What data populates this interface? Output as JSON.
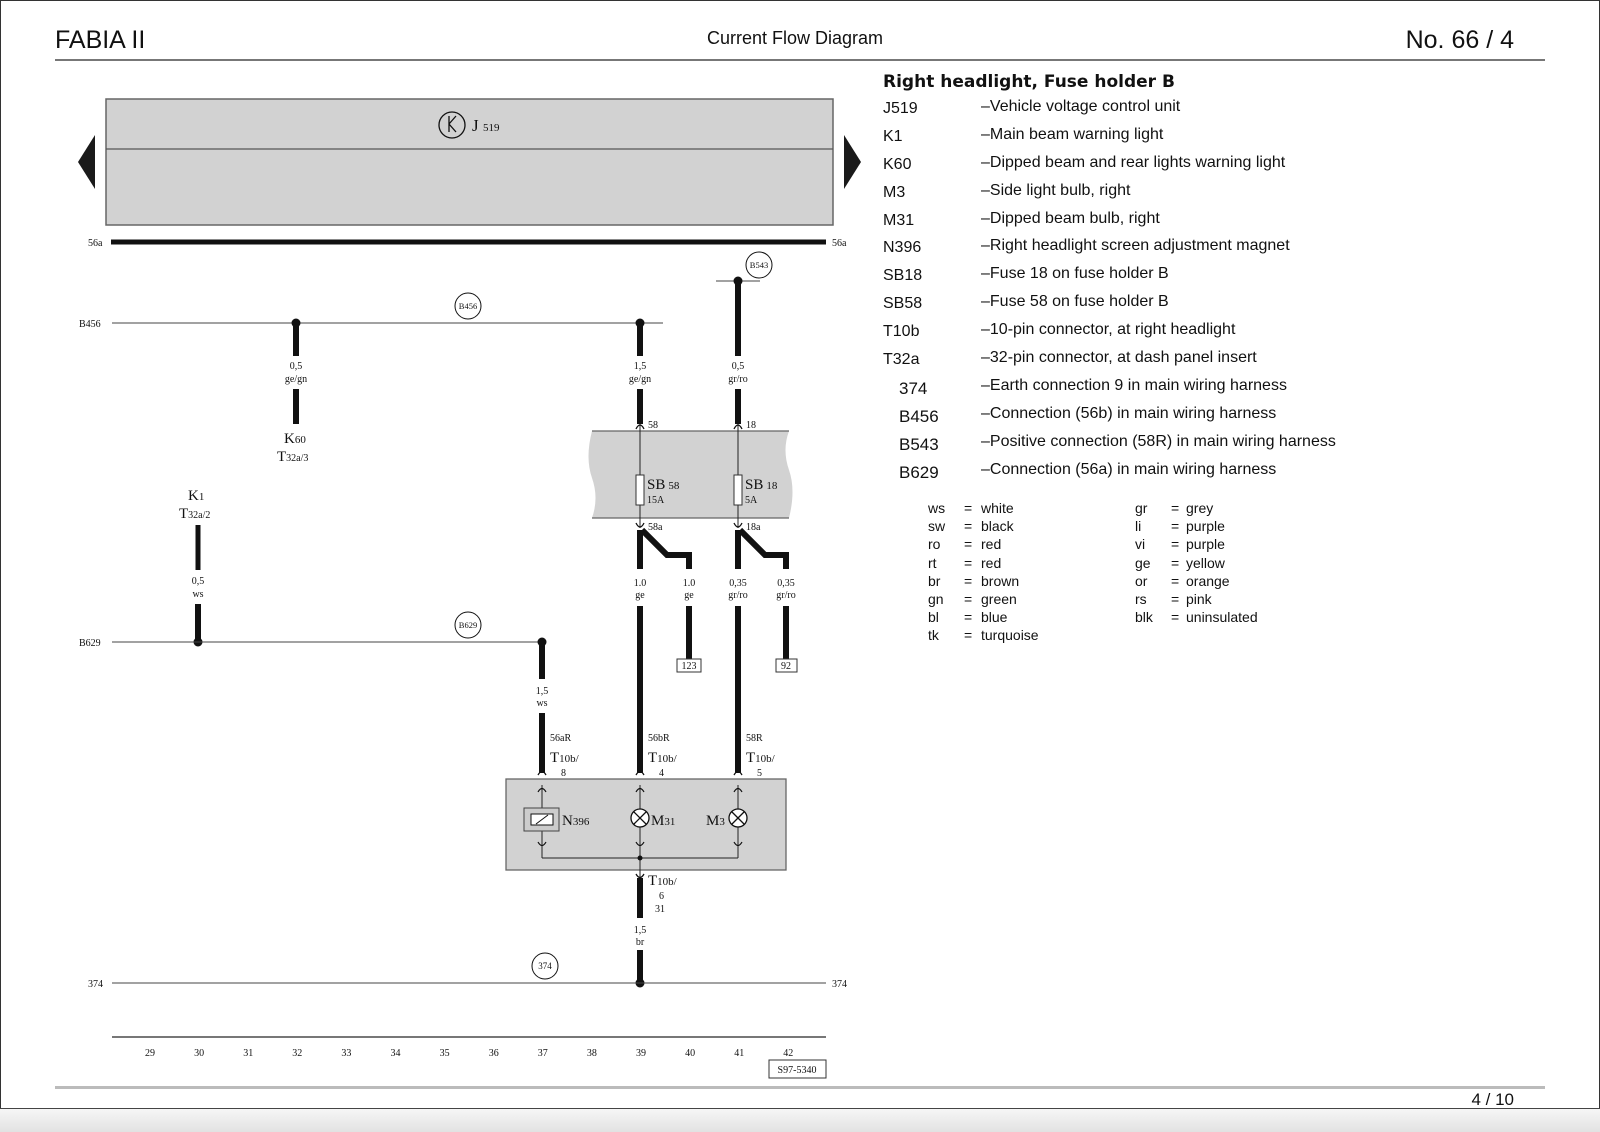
{
  "header": {
    "model": "FABIA II",
    "title": "Current Flow Diagram",
    "doc_number": "No.  66 / 4"
  },
  "footer": {
    "page": "4 /  10"
  },
  "legend": {
    "title": "Right headlight, Fuse holder B",
    "items": [
      {
        "code": "J519",
        "desc": "–Vehicle voltage control unit"
      },
      {
        "code": "K1",
        "desc": "–Main beam warning light"
      },
      {
        "code": "K60",
        "desc": "–Dipped beam and rear lights warning light"
      },
      {
        "code": "M3",
        "desc": "–Side light bulb, right"
      },
      {
        "code": "M31",
        "desc": "–Dipped beam bulb, right"
      },
      {
        "code": "N396",
        "desc": "–Right headlight screen adjustment magnet"
      },
      {
        "code": "SB18",
        "desc": "–Fuse 18 on fuse holder B"
      },
      {
        "code": "SB58",
        "desc": "–Fuse 58 on fuse holder B"
      },
      {
        "code": "T10b",
        "desc": "–10-pin connector, at right headlight"
      },
      {
        "code": "T32a",
        "desc": "–32-pin connector, at dash panel insert"
      },
      {
        "code": "374",
        "desc": "–Earth connection 9 in main wiring harness"
      },
      {
        "code": "B456",
        "desc": "–Connection (56b) in main wiring harness"
      },
      {
        "code": "B543",
        "desc": "–Positive connection (58R) in main wiring harness"
      },
      {
        "code": "B629",
        "desc": "–Connection (56a) in main wiring harness"
      }
    ]
  },
  "wire_colors": {
    "left": [
      {
        "abbr": "ws",
        "name": "white"
      },
      {
        "abbr": "sw",
        "name": "black"
      },
      {
        "abbr": "ro",
        "name": "red"
      },
      {
        "abbr": "rt",
        "name": "red"
      },
      {
        "abbr": "br",
        "name": "brown"
      },
      {
        "abbr": "gn",
        "name": "green"
      },
      {
        "abbr": "bl",
        "name": "blue"
      },
      {
        "abbr": "tk",
        "name": "turquoise"
      }
    ],
    "right": [
      {
        "abbr": "gr",
        "name": "grey"
      },
      {
        "abbr": "li",
        "name": "purple"
      },
      {
        "abbr": "vi",
        "name": "purple"
      },
      {
        "abbr": "ge",
        "name": "yellow"
      },
      {
        "abbr": "or",
        "name": "orange"
      },
      {
        "abbr": "rs",
        "name": "pink"
      },
      {
        "abbr": "blk",
        "name": "uninsulated"
      }
    ]
  },
  "diagram": {
    "control_unit": {
      "letter": "J",
      "number": "519"
    },
    "bus_56a": {
      "left": "56a",
      "right": "56a"
    },
    "rails": {
      "b456": {
        "label": "B456",
        "badge": "B456"
      },
      "b629": {
        "label": "B629",
        "badge": "B629"
      },
      "b543": {
        "badge": "B543"
      },
      "earth": {
        "left": "374",
        "right": "374",
        "badge": "374"
      }
    },
    "wires": {
      "k60": {
        "size": "0,5",
        "color": "ge/gn"
      },
      "fuse58_in": {
        "size": "1,5",
        "color": "ge/gn"
      },
      "fuse18_in": {
        "size": "0,5",
        "color": "gr/ro"
      },
      "k1": {
        "size": "0,5",
        "color": "ws"
      },
      "n396": {
        "size": "1,5",
        "color": "ws"
      },
      "m31": {
        "size": "1.0",
        "color": "ge"
      },
      "ref123": {
        "size": "1.0",
        "color": "ge"
      },
      "m3": {
        "size": "0,35",
        "color": "gr/ro"
      },
      "ref92": {
        "size": "0,35",
        "color": "gr/ro"
      },
      "earth": {
        "size": "1,5",
        "color": "br"
      }
    },
    "components": {
      "k60": {
        "name": "K",
        "sub": "60",
        "conn": "T",
        "conn_sub": "32a/3"
      },
      "k1": {
        "name": "K",
        "sub": "1",
        "conn": "T",
        "conn_sub": "32a/2"
      },
      "sb58": {
        "name": "SB",
        "sub": "58",
        "rating": "15A",
        "pin_in": "58",
        "pin_out": "58a"
      },
      "sb18": {
        "name": "SB",
        "sub": "18",
        "rating": "5A",
        "pin_in": "18",
        "pin_out": "18a"
      },
      "n396": {
        "name": "N",
        "sub": "396",
        "terminal": "56aR",
        "conn": "T",
        "conn_sub": "10b/",
        "pin": "8"
      },
      "m31": {
        "name": "M",
        "sub": "31",
        "terminal": "56bR",
        "conn": "T",
        "conn_sub": "10b/",
        "pin": "4"
      },
      "m3": {
        "name": "M",
        "sub": "3",
        "terminal": "58R",
        "conn": "T",
        "conn_sub": "10b/",
        "pin": "5"
      },
      "earth_conn": {
        "conn": "T",
        "conn_sub": "10b/",
        "pin": "6",
        "terminal": "31"
      }
    },
    "refs": {
      "ref123": "123",
      "ref92": "92"
    },
    "ruler": [
      "29",
      "30",
      "31",
      "32",
      "33",
      "34",
      "35",
      "36",
      "37",
      "38",
      "39",
      "40",
      "41",
      "42"
    ],
    "drawing_id": "S97-5340"
  }
}
